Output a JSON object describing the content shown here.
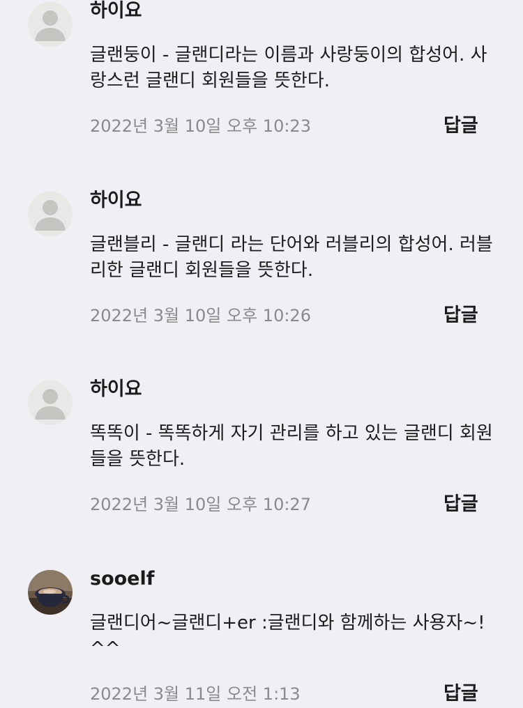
{
  "comments": [
    {
      "author": "하이요",
      "avatar_icon": "default-user-avatar-icon",
      "text": "글랜둥이 - 글랜디라는 이름과 사랑둥이의 합성어. 사랑스런 글랜디 회원들을 뜻한다.",
      "timestamp": "2022년 3월 10일 오후 10:23",
      "reply_label": "답글"
    },
    {
      "author": "하이요",
      "avatar_icon": "default-user-avatar-icon",
      "text": "글랜블리 - 글랜디 라는 단어와 러블리의 합성어. 러블리한 글랜디 회원들을 뜻한다.",
      "timestamp": "2022년 3월 10일 오후 10:26",
      "reply_label": "답글"
    },
    {
      "author": "하이요",
      "avatar_icon": "default-user-avatar-icon",
      "text": "똑똑이 - 똑똑하게 자기 관리를 하고 있는 글랜디 회원들을 뜻한다.",
      "timestamp": "2022년 3월 10일 오후 10:27",
      "reply_label": "답글"
    },
    {
      "author": "sooelf",
      "avatar_icon": "coffee-cup-photo-avatar",
      "text": "글랜디어~글랜디+er :글랜디와 함께하는 사용자~!^^",
      "timestamp": "2022년 3월 11일 오전 1:13",
      "reply_label": "답글"
    }
  ]
}
